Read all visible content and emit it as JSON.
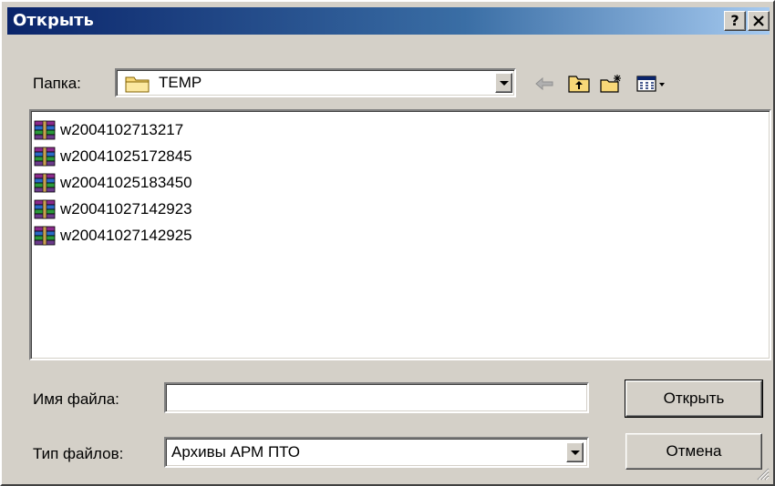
{
  "window": {
    "title": "Открыть",
    "help_button": "?",
    "close_button": "×"
  },
  "folder": {
    "label": "Папка:",
    "value": "TEMP",
    "icon": "folder-icon"
  },
  "toolbar": {
    "back_icon": "back-arrow-icon",
    "up_icon": "up-folder-icon",
    "new_folder_icon": "new-folder-icon",
    "view_icon": "view-menu-icon"
  },
  "files": [
    {
      "name": "w2004102713217",
      "icon": "rar-archive-icon"
    },
    {
      "name": "w20041025172845",
      "icon": "rar-archive-icon"
    },
    {
      "name": "w20041025183450",
      "icon": "rar-archive-icon"
    },
    {
      "name": "w20041027142923",
      "icon": "rar-archive-icon"
    },
    {
      "name": "w20041027142925",
      "icon": "rar-archive-icon"
    }
  ],
  "filename": {
    "label": "Имя файла:",
    "value": ""
  },
  "filetype": {
    "label": "Тип файлов:",
    "value": "Архивы АРМ ПТО"
  },
  "buttons": {
    "open": "Открыть",
    "cancel": "Отмена"
  },
  "colors": {
    "titlebar_start": "#0a246a",
    "titlebar_end": "#a6caf0",
    "face": "#d4d0c8"
  }
}
